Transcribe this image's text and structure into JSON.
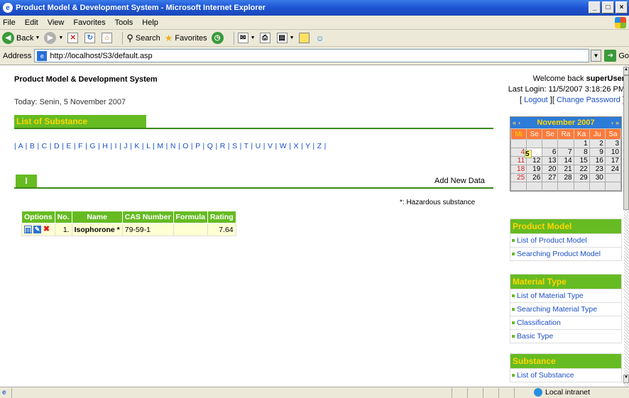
{
  "window": {
    "title": "Product Model & Development System - Microsoft Internet Explorer"
  },
  "menu": [
    "File",
    "Edit",
    "View",
    "Favorites",
    "Tools",
    "Help"
  ],
  "toolbar": {
    "back": "Back",
    "search": "Search",
    "favorites": "Favorites"
  },
  "address": {
    "label": "Address",
    "url": "http://localhost/S3/default.asp",
    "go": "Go"
  },
  "header": {
    "site_title": "Product Model & Development System",
    "today": "Today: Senin, 5 November 2007",
    "welcome_prefix": "Welcome back ",
    "user": "superUser",
    "last_login": "Last Login: 11/5/2007 3:18:26 PM",
    "logout": "Logout",
    "change_password": "Change Password"
  },
  "main": {
    "section_title": "List of Substance",
    "letters": [
      "A",
      "B",
      "C",
      "D",
      "E",
      "F",
      "G",
      "H",
      "I",
      "J",
      "K",
      "L",
      "M",
      "N",
      "O",
      "P",
      "Q",
      "R",
      "S",
      "T",
      "U",
      "V",
      "W",
      "X",
      "Y",
      "Z"
    ],
    "active_letter": "I",
    "add_new": "Add New Data",
    "hazard_note": "*: Hazardous substance",
    "columns": [
      "Options",
      "No.",
      "Name",
      "CAS Number",
      "Formula",
      "Rating"
    ],
    "rows": [
      {
        "no": "1.",
        "name": "Isophorone *",
        "cas": "79-59-1",
        "formula": "",
        "rating": "7.64"
      }
    ]
  },
  "calendar": {
    "prev2": "«",
    "prev": "‹",
    "next": "›",
    "next2": "»",
    "month": "November 2007",
    "days": [
      "Mi",
      "Se",
      "Se",
      "Ra",
      "Ka",
      "Ju",
      "Sa"
    ],
    "weeks": [
      [
        "",
        "",
        "",
        "",
        "1",
        "2",
        "3"
      ],
      [
        "4",
        "5",
        "6",
        "7",
        "8",
        "9",
        "10"
      ],
      [
        "11",
        "12",
        "13",
        "14",
        "15",
        "16",
        "17"
      ],
      [
        "18",
        "19",
        "20",
        "21",
        "22",
        "23",
        "24"
      ],
      [
        "25",
        "26",
        "27",
        "28",
        "29",
        "30",
        ""
      ],
      [
        "",
        "",
        "",
        "",
        "",
        "",
        ""
      ]
    ],
    "today": "5"
  },
  "sidebar": [
    {
      "title": "Product Model",
      "items": [
        "List of Product Model",
        "Searching Product Model"
      ]
    },
    {
      "title": "Material Type",
      "items": [
        "List of Material Type",
        "Searching Material Type",
        "Classification",
        "Basic Type"
      ]
    },
    {
      "title": "Substance",
      "items": [
        "List of Substance"
      ]
    }
  ],
  "status": {
    "zone": "Local intranet"
  },
  "colors": {
    "accent_green": "#66bb22",
    "title_yellow": "#ffd700",
    "link_blue": "#1a50c8"
  }
}
